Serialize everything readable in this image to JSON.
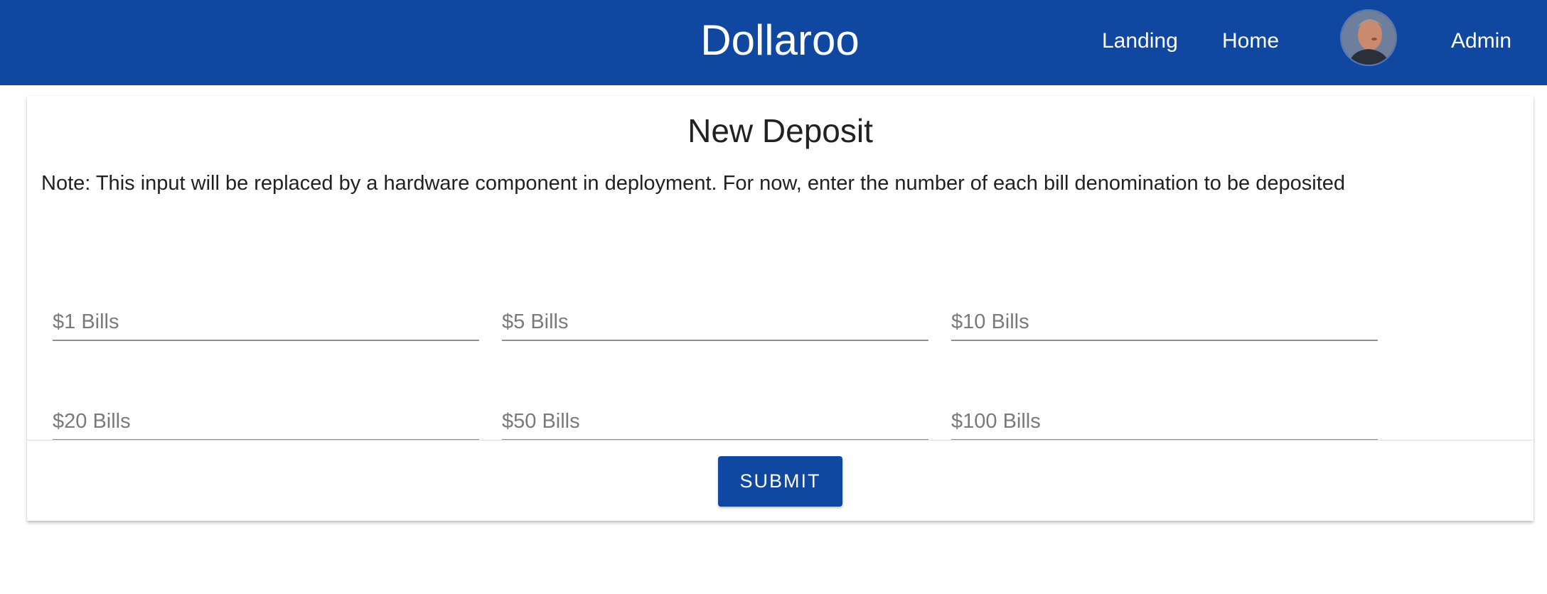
{
  "header": {
    "brand": "Dollaroo",
    "nav": {
      "landing": "Landing",
      "home": "Home",
      "admin": "Admin"
    },
    "avatar": "user-avatar",
    "color": "#0f47a1"
  },
  "card": {
    "title": "New Deposit",
    "note": "Note: This input will be replaced by a hardware component in deployment. For now, enter the number of each bill denomination to be deposited",
    "fields": {
      "bills_1": {
        "placeholder": "$1 Bills",
        "value": ""
      },
      "bills_5": {
        "placeholder": "$5 Bills",
        "value": ""
      },
      "bills_10": {
        "placeholder": "$10 Bills",
        "value": ""
      },
      "bills_20": {
        "placeholder": "$20 Bills",
        "value": ""
      },
      "bills_50": {
        "placeholder": "$50 Bills",
        "value": ""
      },
      "bills_100": {
        "placeholder": "$100 Bills",
        "value": ""
      }
    },
    "submit_label": "SUBMIT"
  }
}
